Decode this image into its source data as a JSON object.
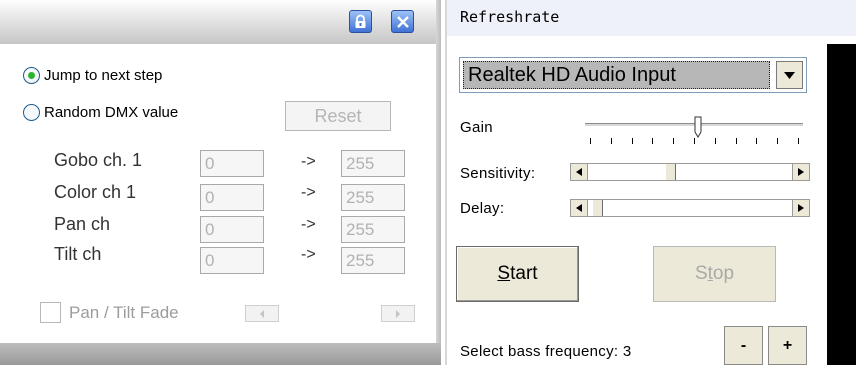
{
  "left_panel": {
    "radios": [
      {
        "label": "Jump to next step",
        "selected": true
      },
      {
        "label": "Random DMX value",
        "selected": false
      }
    ],
    "reset_label": "Reset",
    "channels": [
      {
        "label": "Gobo ch. 1",
        "from": "0",
        "arrow": "->",
        "to": "255"
      },
      {
        "label": "Color ch 1",
        "from": "0",
        "arrow": "->",
        "to": "255"
      },
      {
        "label": "Pan ch",
        "from": "0",
        "arrow": "->",
        "to": "255"
      },
      {
        "label": "Tilt ch",
        "from": "0",
        "arrow": "->",
        "to": "255"
      }
    ],
    "pan_tilt_fade_label": "Pan / Tilt Fade",
    "pan_tilt_fade_checked": false,
    "icons": {
      "lock": "lock-icon",
      "close": "close-icon"
    },
    "accent_color": "#3f72d4",
    "radio_selected_color": "#2bb52b"
  },
  "right_panel": {
    "title": "Refreshrate",
    "device_select": {
      "value": "Realtek HD Audio Input"
    },
    "gain": {
      "label": "Gain",
      "level": 0.52
    },
    "sensitivity": {
      "label": "Sensitivity:",
      "level": 0.4
    },
    "delay": {
      "label": "Delay:",
      "level": 0.02
    },
    "start": {
      "underlined": "S",
      "rest": "tart"
    },
    "stop": {
      "first": "S",
      "underlined": "t",
      "rest": "op"
    },
    "bass": {
      "label": "Select bass frequency: 3",
      "minus": "-",
      "plus": "+"
    }
  }
}
